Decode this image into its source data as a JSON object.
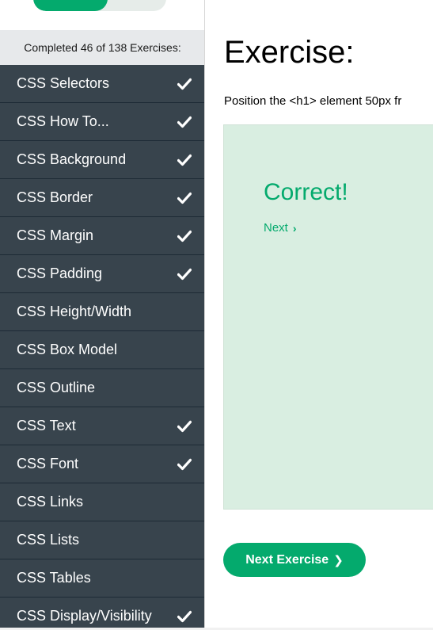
{
  "sidebar": {
    "progress_text": "Completed 46 of 138 Exercises:",
    "items": [
      {
        "label": "CSS Selectors",
        "completed": true
      },
      {
        "label": "CSS How To...",
        "completed": true
      },
      {
        "label": "CSS Background",
        "completed": true
      },
      {
        "label": "CSS Border",
        "completed": true
      },
      {
        "label": "CSS Margin",
        "completed": true
      },
      {
        "label": "CSS Padding",
        "completed": true
      },
      {
        "label": "CSS Height/Width",
        "completed": false
      },
      {
        "label": "CSS Box Model",
        "completed": false
      },
      {
        "label": "CSS Outline",
        "completed": false
      },
      {
        "label": "CSS Text",
        "completed": true
      },
      {
        "label": "CSS Font",
        "completed": true
      },
      {
        "label": "CSS Links",
        "completed": false
      },
      {
        "label": "CSS Lists",
        "completed": false
      },
      {
        "label": "CSS Tables",
        "completed": false
      },
      {
        "label": "CSS Display/Visibility",
        "completed": true
      }
    ]
  },
  "main": {
    "title": "Exercise:",
    "instructions": "Position the <h1> element 50px fr",
    "result": {
      "status": "Correct!",
      "next_link": "Next",
      "next_link_icon": "chevron-right-icon"
    },
    "next_button": "Next Exercise",
    "next_button_icon": "chevron-right-icon"
  },
  "colors": {
    "accent": "#04aa6d",
    "sidebar_bg": "#38444d",
    "result_bg": "#d9eee1"
  }
}
